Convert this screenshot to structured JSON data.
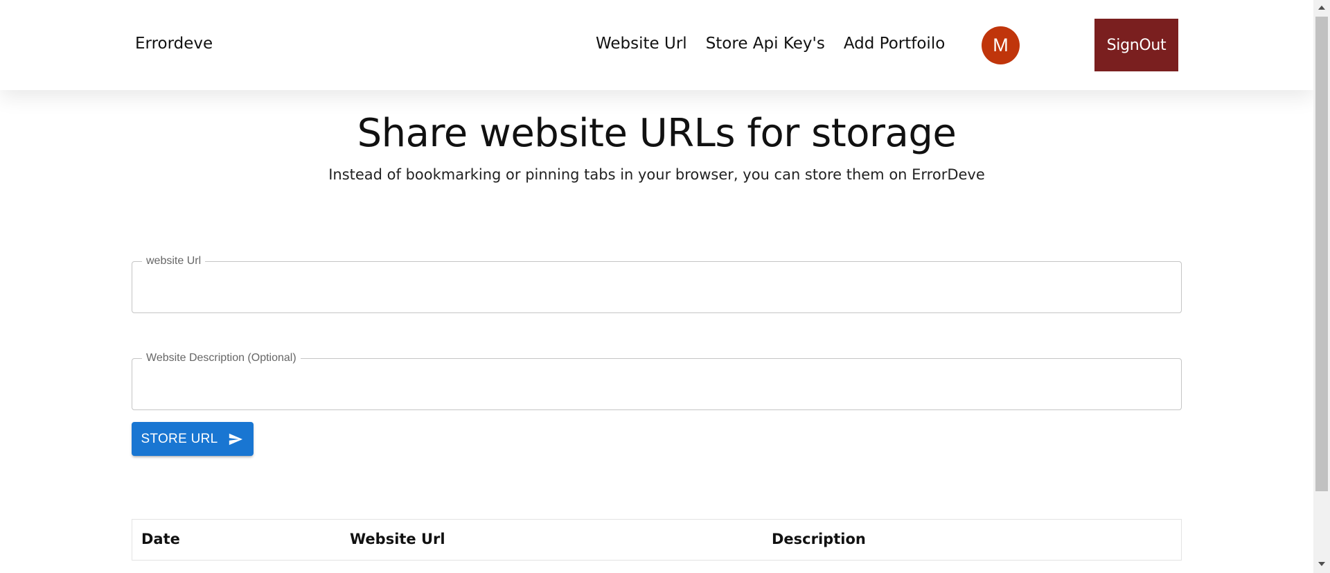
{
  "navbar": {
    "brand": "Errordeve",
    "links": [
      "Website Url",
      "Store Api Key's",
      "Add Portfoilo"
    ],
    "avatar_initial": "M",
    "signout_label": "SignOut"
  },
  "hero": {
    "title": "Share website URLs for storage",
    "subtitle": "Instead of bookmarking or pinning tabs in your browser, you can store them on ErrorDeve"
  },
  "form": {
    "url_label": "website Url",
    "url_value": "",
    "description_label": "Website Description (Optional)",
    "description_value": "",
    "submit_label": "STORE URL"
  },
  "table": {
    "columns": [
      "Date",
      "Website Url",
      "Description"
    ],
    "rows": []
  },
  "icons": {
    "submit_icon": "send-icon"
  },
  "colors": {
    "avatar_bg": "#c0350b",
    "signout_bg": "#7a1f1f",
    "primary_button": "#1976d2"
  }
}
